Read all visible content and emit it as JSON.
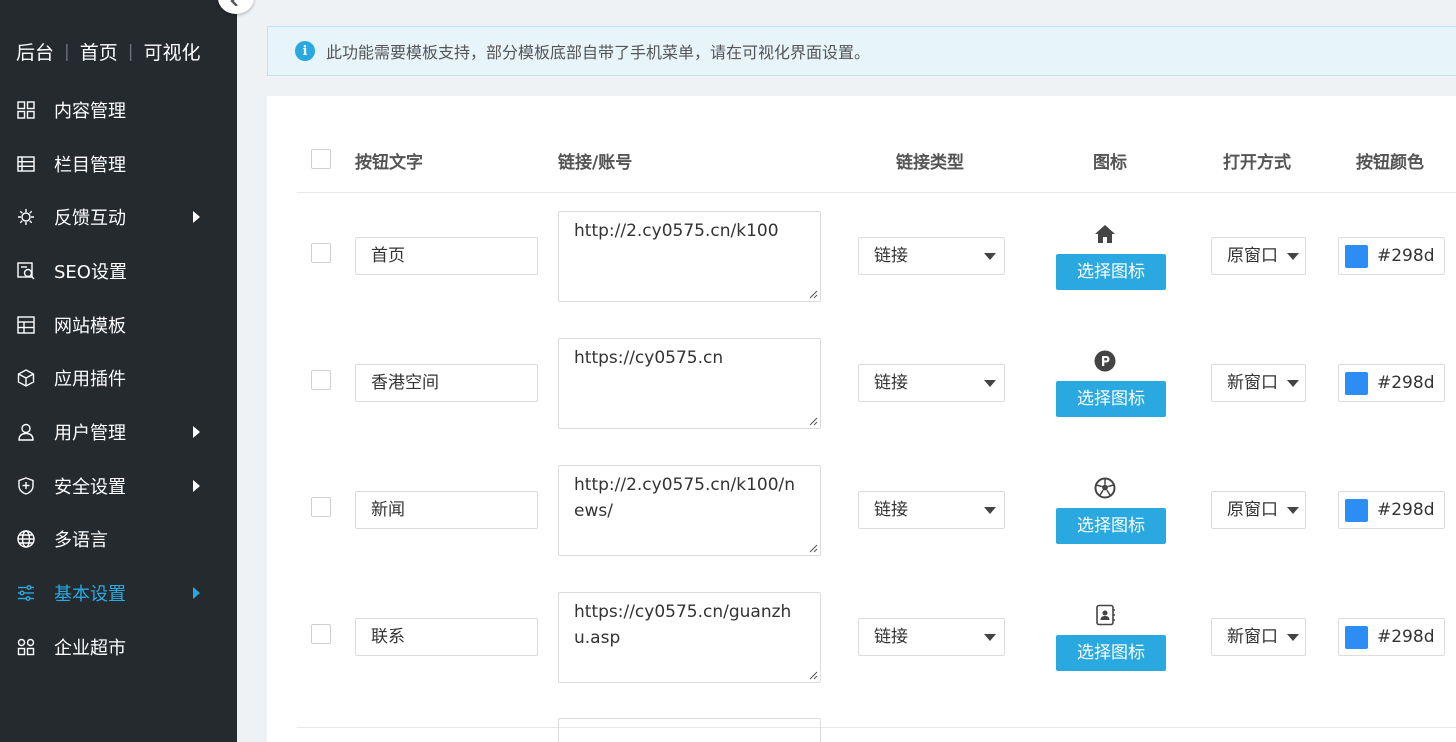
{
  "sidebar": {
    "top_links": [
      "后台",
      "首页",
      "可视化"
    ],
    "items": [
      {
        "label": "内容管理",
        "icon": "grid-icon",
        "arrow": false,
        "active": false
      },
      {
        "label": "栏目管理",
        "icon": "list-icon",
        "arrow": false,
        "active": false
      },
      {
        "label": "反馈互动",
        "icon": "feedback-icon",
        "arrow": true,
        "active": false
      },
      {
        "label": "SEO设置",
        "icon": "seo-icon",
        "arrow": false,
        "active": false
      },
      {
        "label": "网站模板",
        "icon": "template-icon",
        "arrow": false,
        "active": false
      },
      {
        "label": "应用插件",
        "icon": "cube-icon",
        "arrow": false,
        "active": false
      },
      {
        "label": "用户管理",
        "icon": "user-icon",
        "arrow": true,
        "active": false
      },
      {
        "label": "安全设置",
        "icon": "shield-icon",
        "arrow": true,
        "active": false
      },
      {
        "label": "多语言",
        "icon": "globe-icon",
        "arrow": false,
        "active": false
      },
      {
        "label": "基本设置",
        "icon": "sliders-icon",
        "arrow": true,
        "active": true
      },
      {
        "label": "企业超市",
        "icon": "apps-icon",
        "arrow": false,
        "active": false
      }
    ]
  },
  "notice": {
    "text": "此功能需要模板支持，部分模板底部自带了手机菜单，请在可视化界面设置。",
    "icon": "info-icon"
  },
  "table": {
    "headers": {
      "text": "按钮文字",
      "link": "链接/账号",
      "type": "链接类型",
      "icon": "图标",
      "open": "打开方式",
      "color": "按钮颜色"
    },
    "select_icon_label": "选择图标",
    "rows": [
      {
        "text": "首页",
        "link": "http://2.cy0575.cn/k100",
        "type": "链接",
        "icon": "home-icon",
        "open": "原窗口",
        "color": "#298d",
        "swatch": "#2c8df4"
      },
      {
        "text": "香港空间",
        "link": "https://cy0575.cn",
        "type": "链接",
        "icon": "parking-icon",
        "open": "新窗口",
        "color": "#298d",
        "swatch": "#2c8df4"
      },
      {
        "text": "新闻",
        "link": "http://2.cy0575.cn/k100/news/",
        "type": "链接",
        "icon": "soccer-ball-icon",
        "open": "原窗口",
        "color": "#298d",
        "swatch": "#2c8df4"
      },
      {
        "text": "联系",
        "link": "https://cy0575.cn/guanzhu.asp",
        "type": "链接",
        "icon": "contact-card-icon",
        "open": "新窗口",
        "color": "#298d",
        "swatch": "#2c8df4"
      }
    ]
  },
  "colors": {
    "accent": "#2aa9e0",
    "sidebar_bg": "#252a2f"
  }
}
